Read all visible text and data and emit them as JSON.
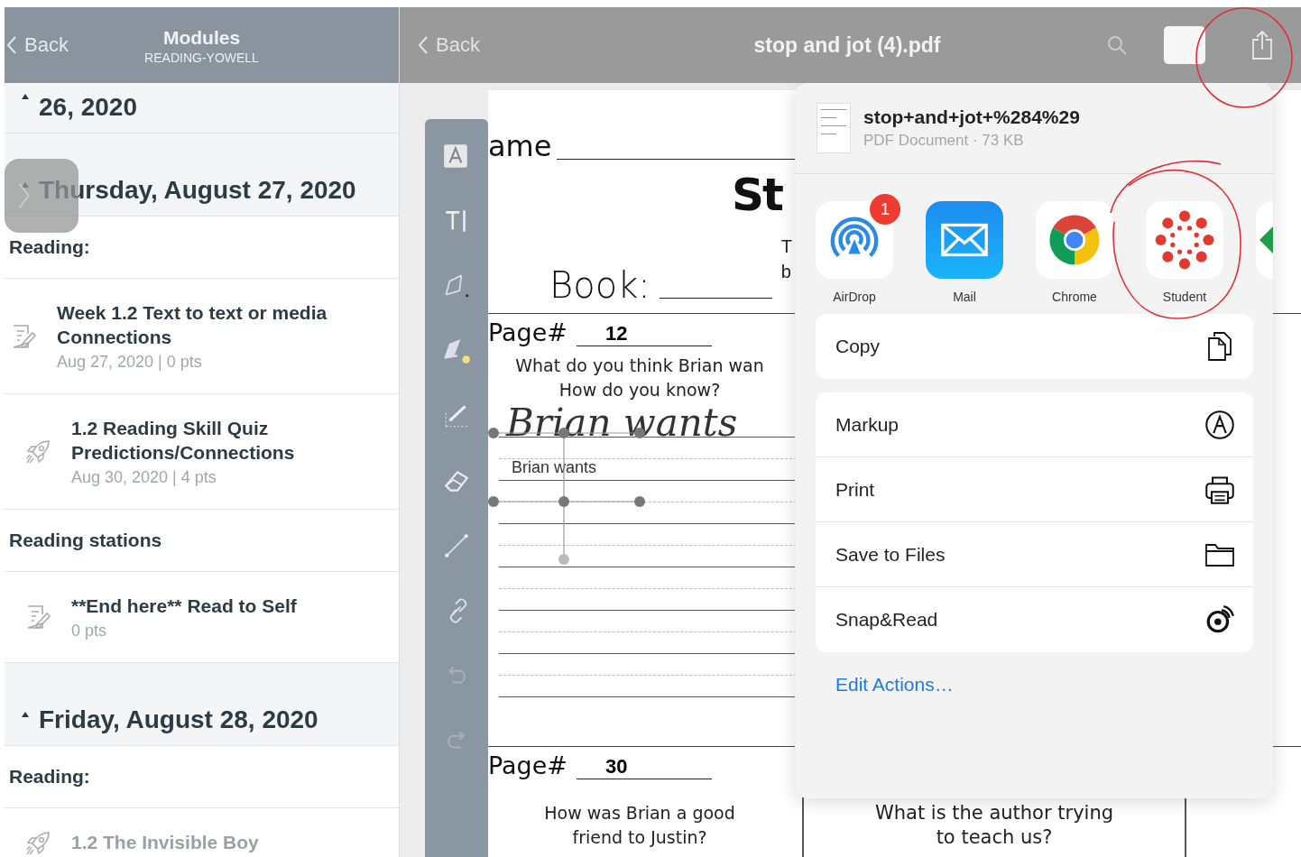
{
  "modules_nav": {
    "back": "Back",
    "title": "Modules",
    "subtitle": "READING-YOWELL"
  },
  "modules": [
    {
      "kind": "day",
      "title": "26, 2020",
      "expanded": true
    },
    {
      "kind": "day",
      "title": "Thursday, August 27, 2020",
      "expanded": true
    },
    {
      "kind": "header",
      "title": "Reading:"
    },
    {
      "kind": "assignment",
      "title": "Week 1.2 Text to text or media Connections",
      "meta": "Aug 27, 2020 | 0 pts",
      "indented": false,
      "disabled": false
    },
    {
      "kind": "quiz",
      "title": "1.2 Reading Skill Quiz Predictions/Connections",
      "meta": "Aug 30, 2020 | 4 pts",
      "indented": true,
      "disabled": false
    },
    {
      "kind": "header",
      "title": "Reading stations"
    },
    {
      "kind": "assignment",
      "title": "**End here** Read to Self",
      "meta": "0 pts",
      "indented": true,
      "disabled": false
    },
    {
      "kind": "day",
      "title": "Friday, August 28, 2020",
      "expanded": true
    },
    {
      "kind": "header",
      "title": "Reading:"
    },
    {
      "kind": "quiz",
      "title": "1.2  The Invisible Boy",
      "indented": true,
      "disabled": true
    }
  ],
  "pdf_nav": {
    "back": "Back",
    "title": "stop and jot (4).pdf"
  },
  "tools": [
    {
      "kind": "textbox",
      "disabled": false
    },
    {
      "kind": "text",
      "disabled": false
    },
    {
      "kind": "pen",
      "disabled": false
    },
    {
      "kind": "highlighter",
      "disabled": false
    },
    {
      "kind": "ruler",
      "disabled": false
    },
    {
      "kind": "eraser",
      "disabled": false
    },
    {
      "kind": "arrow",
      "disabled": false
    },
    {
      "kind": "link",
      "disabled": false
    },
    {
      "kind": "undo",
      "disabled": true
    },
    {
      "kind": "redo",
      "disabled": true
    }
  ],
  "document": {
    "name_label": "ame",
    "title": "St",
    "book_label": "Book:",
    "side_text": [
      "T",
      "b"
    ],
    "sections": [
      {
        "page_label": "Page#",
        "page_number": "12",
        "question": [
          "What do you think Brian wan",
          "How do you know?"
        ],
        "handwriting": "Brian wants",
        "text_annotation": "Brian wants"
      },
      {
        "page_label": "Page#",
        "page_number": "30",
        "question": [
          "How was Brian a good",
          "friend to Justin?"
        ],
        "question_2": [
          "What is the author trying",
          "to teach us?"
        ]
      }
    ]
  },
  "share_sheet": {
    "file_name": "stop+and+jot+%284%29",
    "file_meta": "PDF Document · 73 KB",
    "apps": [
      {
        "kind": "airdrop",
        "label": "AirDrop",
        "badge": "1"
      },
      {
        "kind": "mail",
        "label": "Mail"
      },
      {
        "kind": "chrome",
        "label": "Chrome"
      },
      {
        "kind": "canvas",
        "label": "Student"
      }
    ],
    "action_groups": [
      [
        {
          "kind": "copy",
          "label": "Copy"
        }
      ],
      [
        {
          "kind": "markup",
          "label": "Markup"
        },
        {
          "kind": "print",
          "label": "Print"
        },
        {
          "kind": "folder",
          "label": "Save to Files"
        },
        {
          "kind": "snapread",
          "label": "Snap&Read"
        }
      ]
    ],
    "edit_actions": "Edit Actions…"
  }
}
